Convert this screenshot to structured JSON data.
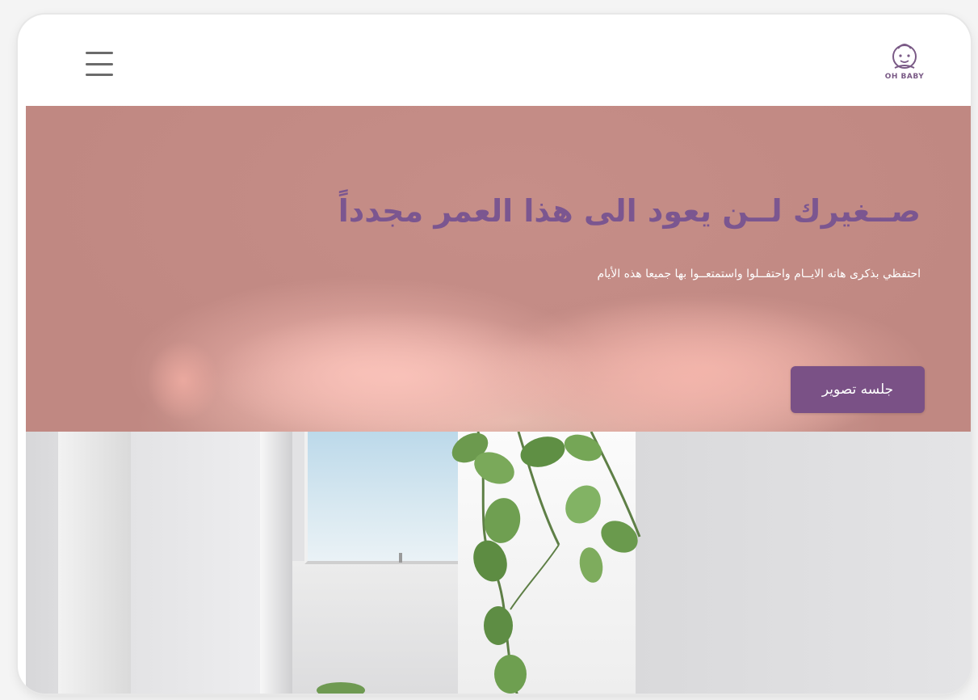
{
  "header": {
    "menu_icon": "hamburger-menu-icon",
    "logo_icon": "baby-face-logo-icon",
    "logo_text": "OH BABY"
  },
  "hero": {
    "title": "صــغيرك لــن يعود الى هذا العمر مجدداً",
    "subtitle": "احتفظي بذكرى هاته الايــام واحتفــلوا واستمتعــوا بها جميعا هذه الأيام",
    "cta_label": "جلسه تصوير"
  },
  "colors": {
    "accent": "#7a5186",
    "title": "#7b5690",
    "hero_background": "#c89791"
  }
}
